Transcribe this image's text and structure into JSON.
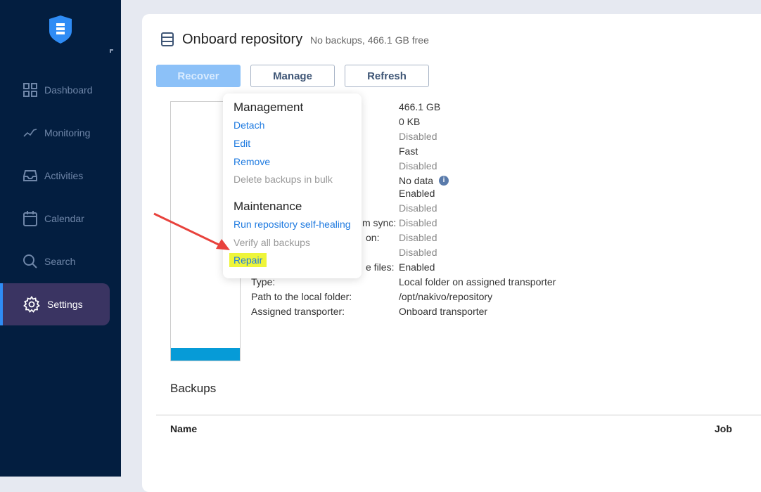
{
  "sidebar": {
    "items": [
      {
        "label": "Dashboard",
        "icon": "dashboard-icon"
      },
      {
        "label": "Monitoring",
        "icon": "monitoring-icon"
      },
      {
        "label": "Activities",
        "icon": "inbox-icon"
      },
      {
        "label": "Calendar",
        "icon": "calendar-icon"
      },
      {
        "label": "Search",
        "icon": "search-icon"
      },
      {
        "label": "Settings",
        "icon": "gear-icon",
        "active": true
      }
    ]
  },
  "header": {
    "title": "Onboard repository",
    "subtitle": "No backups, 466.1 GB free"
  },
  "toolbar": {
    "recover": "Recover",
    "manage": "Manage",
    "refresh": "Refresh"
  },
  "usage": {
    "used_fraction": 0.05
  },
  "details": [
    {
      "label": "",
      "value": "466.1 GB",
      "dim": false
    },
    {
      "label": "",
      "value": "0 KB",
      "dim": false
    },
    {
      "label": "",
      "value": "Disabled",
      "dim": true
    },
    {
      "label": "",
      "value": "Fast",
      "dim": false
    },
    {
      "label": "",
      "value": "Disabled",
      "dim": true
    },
    {
      "label": "",
      "value": "No data",
      "dim": false
    },
    {
      "label": "",
      "value": "Enabled",
      "dim": false
    },
    {
      "label": "",
      "value": "Disabled",
      "dim": true
    },
    {
      "label": "m sync:",
      "value": "Disabled",
      "dim": true
    },
    {
      "label": "on:",
      "value": "Disabled",
      "dim": true
    },
    {
      "label": "",
      "value": "Disabled",
      "dim": true
    },
    {
      "label": "e files:",
      "value": "Enabled",
      "dim": false
    },
    {
      "label": "Type:",
      "value": "Local folder on assigned transporter",
      "dim": false
    },
    {
      "label": "Path to the local folder:",
      "value": "/opt/nakivo/repository",
      "dim": false
    },
    {
      "label": "Assigned transporter:",
      "value": "Onboard transporter",
      "dim": false
    }
  ],
  "menu": {
    "management": "Management",
    "detach": "Detach",
    "edit": "Edit",
    "remove": "Remove",
    "delete_bulk": "Delete backups in bulk",
    "maintenance": "Maintenance",
    "self_heal": "Run repository self-healing",
    "verify": "Verify all backups",
    "repair": "Repair",
    "highlight_color": "#eef53a"
  },
  "backups": {
    "title": "Backups",
    "columns": [
      "Name",
      "Job"
    ]
  }
}
